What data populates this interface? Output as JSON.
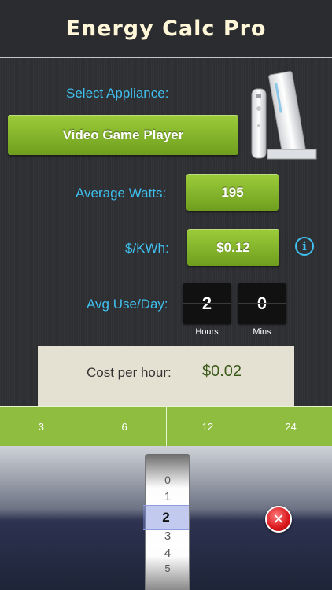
{
  "header": {
    "title": "Energy Calc Pro"
  },
  "appliance": {
    "label": "Select Appliance:",
    "selected": "Video Game Player"
  },
  "watts": {
    "label": "Average Watts:",
    "value": "195"
  },
  "rate": {
    "label": "$/KWh:",
    "value": "$0.12"
  },
  "usage": {
    "label": "Avg Use/Day:",
    "hours": "2",
    "mins": "0",
    "hours_caption": "Hours",
    "mins_caption": "Mins"
  },
  "result": {
    "label": "Cost per hour:",
    "value": "$0.02"
  },
  "segments": [
    "3",
    "6",
    "12",
    "24"
  ],
  "picker": {
    "numbers": [
      "0",
      "1",
      "2",
      "3",
      "4",
      "5"
    ],
    "selected": "2"
  },
  "icons": {
    "info": "info-icon",
    "close": "close-icon",
    "appliance_image": "game-console-icon"
  },
  "colors": {
    "accent_text": "#3fc0ee",
    "button_green": "#7fb02b",
    "result_value": "#3b5a1a",
    "close_red": "#d9161b"
  }
}
